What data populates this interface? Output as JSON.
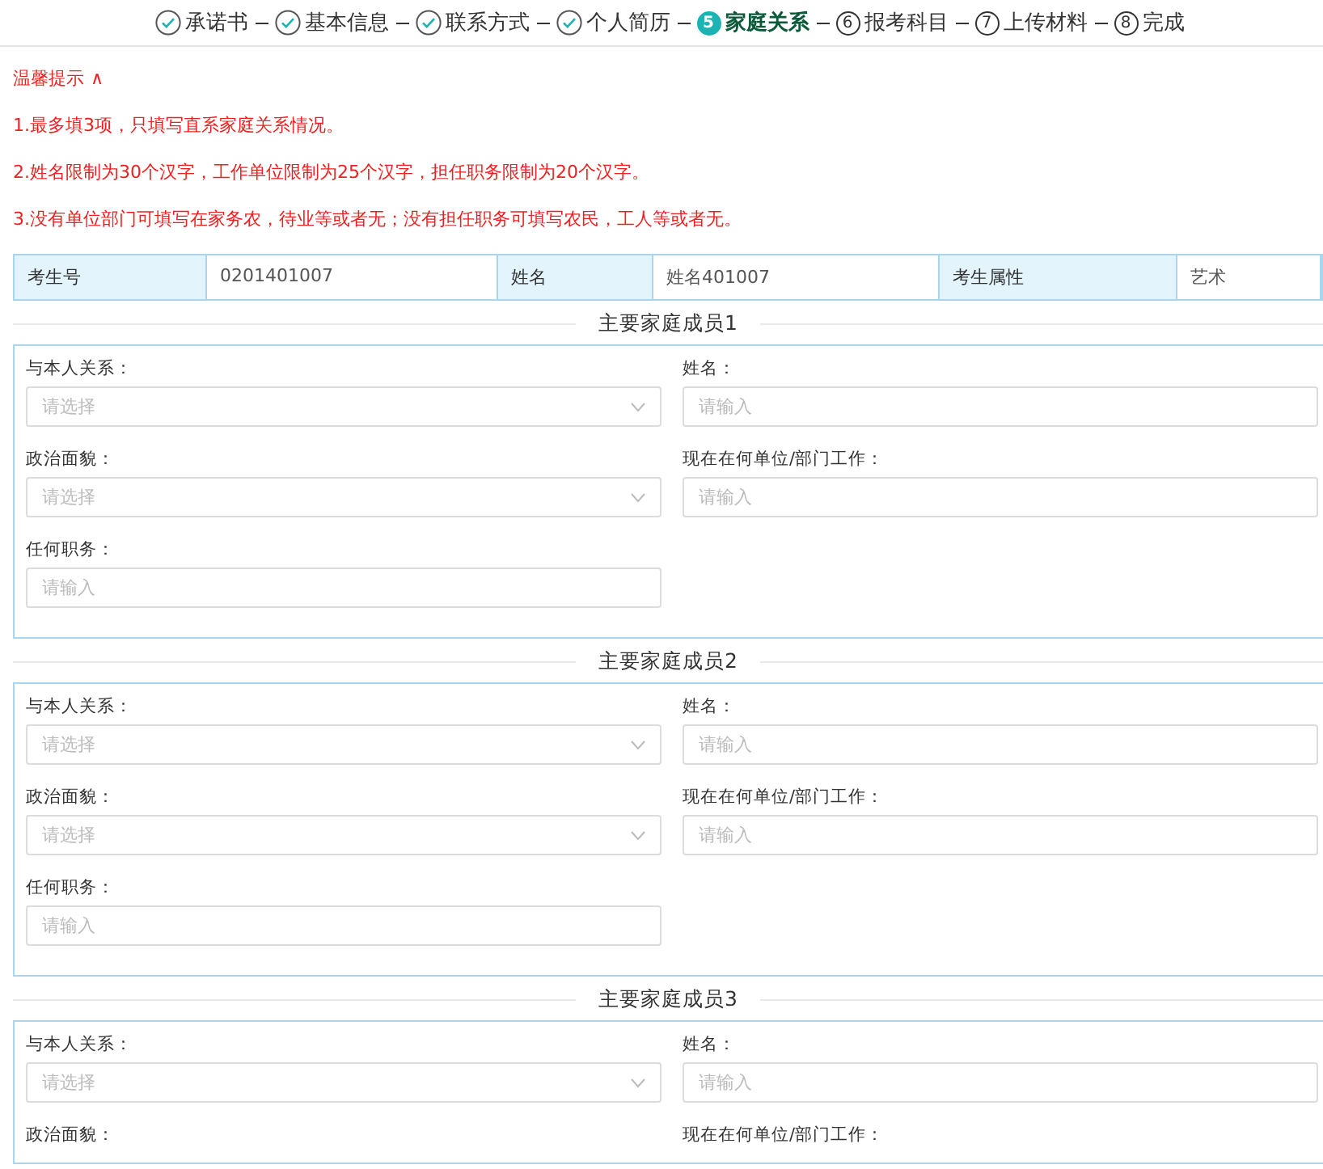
{
  "steps": [
    {
      "label": "承诺书",
      "done": true,
      "selected": false
    },
    {
      "label": "基本信息",
      "done": true,
      "selected": false
    },
    {
      "label": "联系方式",
      "done": true,
      "selected": false
    },
    {
      "label": "个人简历",
      "done": true,
      "selected": false
    },
    {
      "label": "家庭关系",
      "done": false,
      "selected": true,
      "number": "5"
    },
    {
      "label": "报考科目",
      "done": false,
      "selected": false,
      "number": "6"
    },
    {
      "label": "上传材料",
      "done": false,
      "selected": false,
      "number": "7"
    },
    {
      "label": "完成",
      "done": false,
      "selected": false,
      "number": "8"
    }
  ],
  "tips": {
    "title": "温馨提示",
    "toggle": "∧",
    "expanded": true,
    "lines": [
      "1.最多填3项，只填写直系家庭关系情况。",
      "2.姓名限制为30个汉字，工作单位限制为25个汉字，担任职务限制为20个汉字。",
      "3.没有单位部门可填写在家务农，待业等或者无；没有担任职务可填写农民，工人等或者无。"
    ]
  },
  "info": [
    {
      "label": "考生号",
      "value": "0201401007"
    },
    {
      "label": "姓名",
      "value": "姓名401007"
    },
    {
      "label": "考生属性",
      "value": "艺术"
    }
  ],
  "members": [
    {
      "title": "主要家庭成员1",
      "fields": [
        {
          "kind": "select",
          "label": "与本人关系：",
          "placeholder": "请选择"
        },
        {
          "kind": "input",
          "label": "姓名：",
          "placeholder": "请输入"
        },
        {
          "kind": "select",
          "label": "政治面貌：",
          "placeholder": "请选择"
        },
        {
          "kind": "input",
          "label": "现在在何单位/部门工作：",
          "placeholder": "请输入"
        },
        {
          "kind": "input",
          "label": "任何职务：",
          "placeholder": "请输入"
        }
      ]
    },
    {
      "title": "主要家庭成员2",
      "fields": [
        {
          "kind": "select",
          "label": "与本人关系：",
          "placeholder": "请选择"
        },
        {
          "kind": "input",
          "label": "姓名：",
          "placeholder": "请输入"
        },
        {
          "kind": "select",
          "label": "政治面貌：",
          "placeholder": "请选择"
        },
        {
          "kind": "input",
          "label": "现在在何单位/部门工作：",
          "placeholder": "请输入"
        },
        {
          "kind": "input",
          "label": "任何职务：",
          "placeholder": "请输入"
        }
      ]
    },
    {
      "title": "主要家庭成员3",
      "fields": [
        {
          "kind": "select",
          "label": "与本人关系：",
          "placeholder": "请选择"
        },
        {
          "kind": "input",
          "label": "姓名：",
          "placeholder": "请输入"
        },
        {
          "kind": "label",
          "label": "政治面貌："
        },
        {
          "kind": "label",
          "label": "现在在何单位/部门工作："
        }
      ]
    }
  ]
}
